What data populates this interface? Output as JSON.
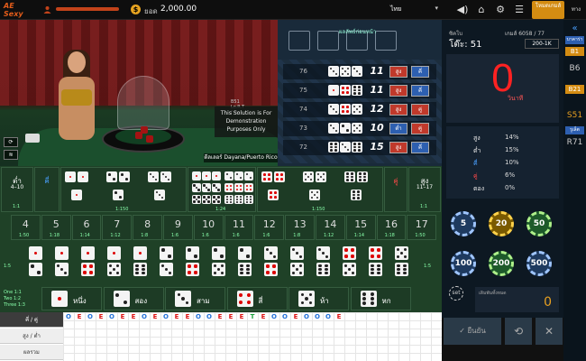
{
  "header": {
    "logo_text": "AE Sexy",
    "balance_label": "ยอด",
    "balance": "2,000.00",
    "language": "ไทย",
    "lobby_label": "โหมดเกมส์",
    "other_games_label": "ทางเลือก",
    "icons": [
      "sound-icon",
      "home-icon",
      "settings-icon"
    ]
  },
  "video": {
    "demo_note": "This Solution is For Demonstration Purposes Only",
    "dealer_name": "ดีลเลอร์ Dayana/Puerto Rico"
  },
  "results": {
    "panel_label": "ผลลัพธ์ก่อนหน้า",
    "rows": [
      {
        "round": "76",
        "dice": [
          3,
          5,
          3
        ],
        "sum": "11",
        "big_small": "สูง",
        "odd_even": "คี่"
      },
      {
        "round": "75",
        "dice": [
          1,
          4,
          6
        ],
        "sum": "11",
        "big_small": "สูง",
        "odd_even": "คี่"
      },
      {
        "round": "74",
        "dice": [
          3,
          4,
          5
        ],
        "sum": "12",
        "big_small": "สูง",
        "odd_even": "คู่"
      },
      {
        "round": "73",
        "dice": [
          3,
          2,
          5
        ],
        "sum": "10",
        "big_small": "ต่ำ",
        "odd_even": "คู่"
      },
      {
        "round": "72",
        "dice": [
          6,
          3,
          6
        ],
        "sum": "15",
        "big_small": "สูง",
        "odd_even": "คี่"
      }
    ]
  },
  "info": {
    "round_label": "ซิคโบ",
    "table_label": "โต๊ะ: 51",
    "game_no": "เกมส์ 6058 / 77",
    "limit": "200-1K",
    "timer": "0",
    "timer_unit": "วินาที",
    "stats": [
      {
        "label": "สูง",
        "value": "14%",
        "color": "#e8e8e8"
      },
      {
        "label": "ต่ำ",
        "value": "15%",
        "color": "#e8e8e8"
      },
      {
        "label": "คี่",
        "value": "10%",
        "color": "#4aa0ff"
      },
      {
        "label": "คู่",
        "value": "6%",
        "color": "#ff4a4a"
      },
      {
        "label": "ตอง",
        "value": "0%",
        "color": "#e8e8e8"
      }
    ]
  },
  "tables": {
    "items": [
      "บาคาร่า",
      "B1",
      "B6",
      "B21",
      "S51",
      "รูเล็ต",
      "R71"
    ],
    "collapse_icon": "double-chevron-left-icon"
  },
  "board": {
    "small_label": "ต่ำ",
    "small_range": "4–10",
    "small_odds": "1:1",
    "odd_label": "คี่",
    "even_label": "คู่",
    "big_label": "สูง",
    "big_range": "11–17",
    "big_odds": "1:1",
    "triple_odds": "1:150",
    "any_triple_odds": "1:24",
    "double_odds": "1:8",
    "totals": [
      {
        "n": "4",
        "odds": "1:50"
      },
      {
        "n": "5",
        "odds": "1:18"
      },
      {
        "n": "6",
        "odds": "1:14"
      },
      {
        "n": "7",
        "odds": "1:12"
      },
      {
        "n": "8",
        "odds": "1:8"
      },
      {
        "n": "9",
        "odds": "1:6"
      },
      {
        "n": "10",
        "odds": "1:6"
      },
      {
        "n": "11",
        "odds": "1:6"
      },
      {
        "n": "12",
        "odds": "1:6"
      },
      {
        "n": "13",
        "odds": "1:8"
      },
      {
        "n": "14",
        "odds": "1:12"
      },
      {
        "n": "15",
        "odds": "1:14"
      },
      {
        "n": "16",
        "odds": "1:18"
      },
      {
        "n": "17",
        "odds": "1:50"
      }
    ],
    "combo_odds": "1:5",
    "single_odds_text": [
      "One 1:1",
      "Two 1:2",
      "Three 1:3"
    ],
    "singles": [
      {
        "face": 1,
        "label": "หนึ่ง"
      },
      {
        "face": 2,
        "label": "สอง"
      },
      {
        "face": 3,
        "label": "สาม"
      },
      {
        "face": 4,
        "label": "สี่"
      },
      {
        "face": 5,
        "label": "ห้า"
      },
      {
        "face": 6,
        "label": "หก"
      }
    ]
  },
  "chips": {
    "values": [
      "5",
      "20",
      "50",
      "100",
      "200",
      "500"
    ],
    "set_label": "set",
    "bet_total_label": "เดิมพันทั้งหมด",
    "bet_total": "0",
    "confirm_label": "ยืนยัน"
  },
  "road": {
    "tabs": [
      "คี่ / คู่",
      "สูง / ต่ำ",
      "ผลรวม"
    ],
    "row1": [
      "O",
      "E",
      "O",
      "E",
      "O",
      "E",
      "E",
      "O",
      "E",
      "O",
      "E",
      "E",
      "O",
      "O",
      "E",
      "E",
      "E",
      "T",
      "E",
      "O",
      "O",
      "E",
      "O",
      "O",
      "O",
      "E"
    ],
    "row1_colors": [
      "#1f6fd6",
      "#d11",
      "#1f6fd6",
      "#d11",
      "#1f6fd6",
      "#d11",
      "#d11",
      "#1f6fd6",
      "#d11",
      "#1f6fd6",
      "#d11",
      "#d11",
      "#1f6fd6",
      "#1f6fd6",
      "#d11",
      "#d11",
      "#d11",
      "#1aa13a",
      "#d11",
      "#1f6fd6",
      "#1f6fd6",
      "#d11",
      "#1f6fd6",
      "#1f6fd6",
      "#1f6fd6",
      "#d11"
    ]
  }
}
